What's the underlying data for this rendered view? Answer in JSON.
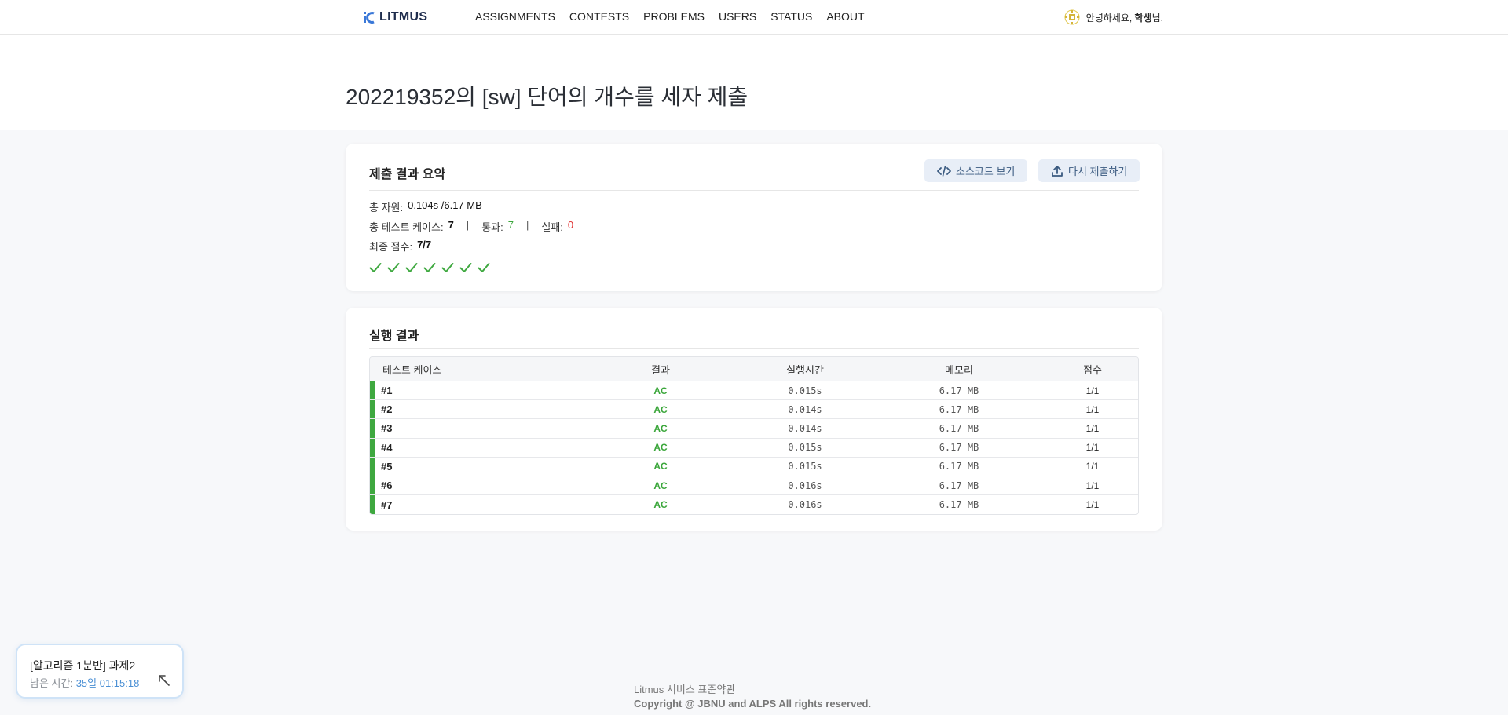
{
  "nav": {
    "logo_text": "LITMUS",
    "menu": [
      "ASSIGNMENTS",
      "CONTESTS",
      "PROBLEMS",
      "USERS",
      "STATUS",
      "ABOUT"
    ],
    "greeting_prefix": "안녕하세요, ",
    "user_name": "학생",
    "greeting_suffix": "님."
  },
  "page": {
    "title": "202219352의 [sw] 단어의 개수를 세자 제출"
  },
  "summary": {
    "title": "제출 결과 요약",
    "source_button": "소스코드 보기",
    "resubmit_button": "다시 제출하기",
    "resource_label": "총 자원:",
    "resource_value": "0.104s /6.17 MB",
    "total_cases_label": "총 테스트 케이스:",
    "total_cases_value": "7",
    "separator": "|",
    "pass_label": "통과:",
    "pass_value": "7",
    "fail_label": "실패:",
    "fail_value": "0",
    "score_label": "최종 점수:",
    "score_value": "7/7",
    "check_count": 7
  },
  "results": {
    "title": "실행 결과",
    "headers": {
      "case": "테스트 케이스",
      "result": "결과",
      "time": "실행시간",
      "memory": "메모리",
      "score": "점수"
    },
    "rows": [
      {
        "case": "#1",
        "result": "AC",
        "time": "0.015s",
        "memory": "6.17 MB",
        "score": "1/1"
      },
      {
        "case": "#2",
        "result": "AC",
        "time": "0.014s",
        "memory": "6.17 MB",
        "score": "1/1"
      },
      {
        "case": "#3",
        "result": "AC",
        "time": "0.014s",
        "memory": "6.17 MB",
        "score": "1/1"
      },
      {
        "case": "#4",
        "result": "AC",
        "time": "0.015s",
        "memory": "6.17 MB",
        "score": "1/1"
      },
      {
        "case": "#5",
        "result": "AC",
        "time": "0.015s",
        "memory": "6.17 MB",
        "score": "1/1"
      },
      {
        "case": "#6",
        "result": "AC",
        "time": "0.016s",
        "memory": "6.17 MB",
        "score": "1/1"
      },
      {
        "case": "#7",
        "result": "AC",
        "time": "0.016s",
        "memory": "6.17 MB",
        "score": "1/1"
      }
    ]
  },
  "assignment_widget": {
    "title": "[알고리즘 1분반] 과제2",
    "remaining_label": "남은 시간: ",
    "remaining_value": "35일 01:15:18"
  },
  "footer": {
    "terms": "Litmus 서비스 표준약관",
    "copyright": "Copyright @ JBNU and ALPS All rights reserved."
  },
  "colors": {
    "accent_green": "#3ea83f",
    "fail_red": "#e03131",
    "button_bg": "#e8eef7",
    "link_blue": "#4a8fd4"
  }
}
